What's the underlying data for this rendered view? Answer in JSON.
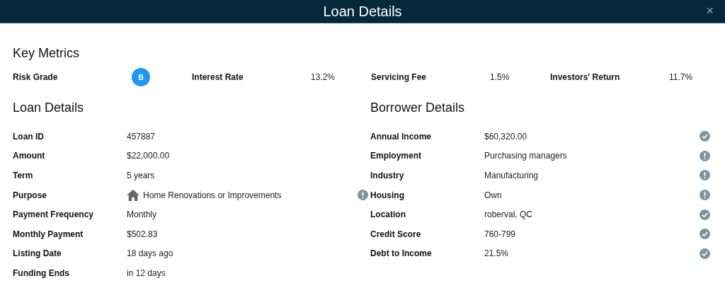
{
  "window": {
    "title": "Loan Details",
    "close": "×"
  },
  "key_metrics": {
    "title": "Key Metrics",
    "items": [
      {
        "label": "Risk Grade",
        "value": "B",
        "kind": "badge"
      },
      {
        "label": "Interest Rate",
        "value": "13.2%",
        "kind": "text"
      },
      {
        "label": "Servicing Fee",
        "value": "1.5%",
        "kind": "text"
      },
      {
        "label": "Investors' Return",
        "value": "11.7%",
        "kind": "text"
      }
    ]
  },
  "loan_details": {
    "title": "Loan Details",
    "rows": [
      {
        "label": "Loan ID",
        "value": "457887",
        "house_icon": false,
        "kind": "plain"
      },
      {
        "label": "Amount",
        "value": "$22,000.00",
        "house_icon": false,
        "kind": "plain"
      },
      {
        "label": "Term",
        "value": "5 years",
        "house_icon": false,
        "kind": "plain"
      },
      {
        "label": "Purpose",
        "value": "Home Renovations or Improvements",
        "house_icon": true,
        "kind": "alert"
      },
      {
        "label": "Payment Frequency",
        "value": "Monthly",
        "house_icon": false,
        "kind": "plain"
      },
      {
        "label": "Monthly Payment",
        "value": "$502.83",
        "house_icon": false,
        "kind": "plain"
      },
      {
        "label": "Listing Date",
        "value": "18 days ago",
        "house_icon": false,
        "kind": "plain"
      },
      {
        "label": "Funding Ends",
        "value": "in 12 days",
        "house_icon": false,
        "kind": "plain"
      }
    ]
  },
  "borrower_details": {
    "title": "Borrower Details",
    "rows": [
      {
        "label": "Annual Income",
        "value": "$60,320.00",
        "kind": "verified"
      },
      {
        "label": "Employment",
        "value": "Purchasing managers",
        "kind": "alert"
      },
      {
        "label": "Industry",
        "value": "Manufacturing",
        "kind": "alert"
      },
      {
        "label": "Housing",
        "value": "Own",
        "kind": "alert"
      },
      {
        "label": "Location",
        "value": "roberval, QC",
        "kind": "verified"
      },
      {
        "label": "Credit Score",
        "value": "760-799",
        "kind": "verified"
      },
      {
        "label": "Debt to Income",
        "value": "21.5%",
        "kind": "verified"
      }
    ]
  }
}
